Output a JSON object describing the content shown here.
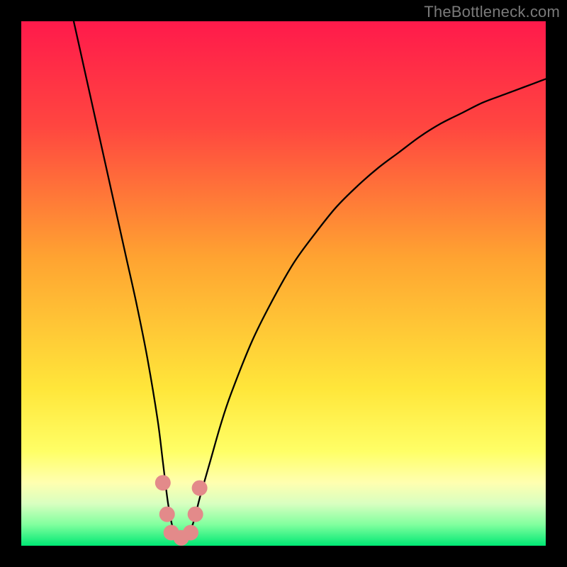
{
  "attribution": "TheBottleneck.com",
  "chart_data": {
    "type": "line",
    "title": "",
    "xlabel": "",
    "ylabel": "",
    "xlim": [
      0,
      100
    ],
    "ylim": [
      0,
      100
    ],
    "background_gradient": {
      "stops": [
        {
          "pct": 0,
          "color": "#ff1a4b"
        },
        {
          "pct": 20,
          "color": "#ff4640"
        },
        {
          "pct": 45,
          "color": "#ffa331"
        },
        {
          "pct": 70,
          "color": "#ffe63a"
        },
        {
          "pct": 82,
          "color": "#ffff66"
        },
        {
          "pct": 88,
          "color": "#ffffb0"
        },
        {
          "pct": 92,
          "color": "#d8ffc0"
        },
        {
          "pct": 96,
          "color": "#80ff9e"
        },
        {
          "pct": 100,
          "color": "#00e874"
        }
      ]
    },
    "series": [
      {
        "name": "bottleneck-curve",
        "color": "#000000",
        "stroke_width": 2.3,
        "x": [
          10,
          12,
          14,
          16,
          18,
          20,
          22,
          24,
          26,
          27,
          28,
          29,
          30,
          31,
          32,
          33,
          34,
          36,
          38,
          40,
          44,
          48,
          52,
          56,
          60,
          64,
          68,
          72,
          76,
          80,
          84,
          88,
          92,
          96,
          100
        ],
        "y": [
          100,
          91,
          82,
          73,
          64,
          55,
          46,
          36,
          24,
          16,
          8,
          3,
          1.5,
          1.5,
          2.5,
          5,
          9,
          16,
          23,
          29,
          39,
          47,
          54,
          59.5,
          64.5,
          68.5,
          72,
          75,
          78,
          80.5,
          82.5,
          84.5,
          86,
          87.5,
          89
        ]
      }
    ],
    "markers": {
      "name": "highlight-points",
      "color": "#e38a8a",
      "radius": 11,
      "points": [
        {
          "x": 27.0,
          "y": 12
        },
        {
          "x": 27.8,
          "y": 6
        },
        {
          "x": 28.6,
          "y": 2.5
        },
        {
          "x": 30.5,
          "y": 1.5
        },
        {
          "x": 32.3,
          "y": 2.5
        },
        {
          "x": 33.2,
          "y": 6
        },
        {
          "x": 34.0,
          "y": 11
        }
      ]
    }
  }
}
